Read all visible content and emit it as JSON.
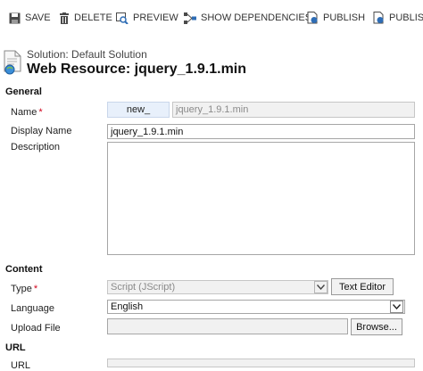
{
  "toolbar": {
    "save": "SAVE",
    "delete": "DELETE",
    "preview": "PREVIEW",
    "show_dependencies": "SHOW DEPENDENCIES",
    "publish": "PUBLISH",
    "publish_all": "PUBLIS"
  },
  "header": {
    "solution": "Solution: Default Solution",
    "title": "Web Resource: jquery_1.9.1.min"
  },
  "general": {
    "section": "General",
    "name_label": "Name",
    "name_prefix": "new_",
    "name_value": "jquery_1.9.1.min",
    "display_name_label": "Display Name",
    "display_name_value": "jquery_1.9.1.min",
    "description_label": "Description",
    "description_value": ""
  },
  "content": {
    "section": "Content",
    "type_label": "Type",
    "type_value": "Script (JScript)",
    "text_editor_button": "Text Editor",
    "language_label": "Language",
    "language_value": "English",
    "upload_label": "Upload File",
    "upload_value": "",
    "browse_button": "Browse..."
  },
  "url": {
    "section": "URL",
    "url_label": "URL"
  },
  "required_marker": "*",
  "colors": {
    "required": "#d0021b",
    "name_prefix_bg": "#e8f0fb",
    "readonly_bg": "#f1f1f1"
  }
}
